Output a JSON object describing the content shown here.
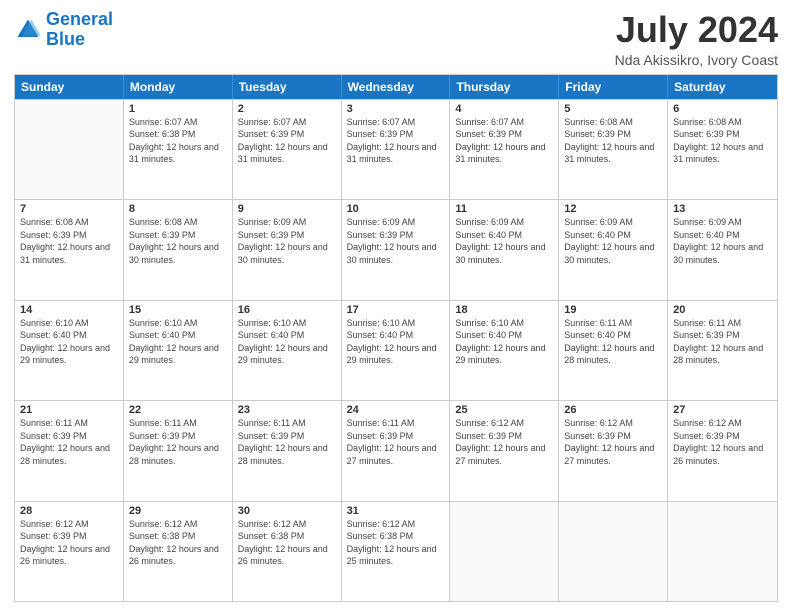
{
  "logo": {
    "line1": "General",
    "line2": "Blue"
  },
  "title": "July 2024",
  "location": "Nda Akissikro, Ivory Coast",
  "weekdays": [
    "Sunday",
    "Monday",
    "Tuesday",
    "Wednesday",
    "Thursday",
    "Friday",
    "Saturday"
  ],
  "weeks": [
    [
      {
        "day": "",
        "empty": true
      },
      {
        "day": "1",
        "sunrise": "6:07 AM",
        "sunset": "6:38 PM",
        "daylight": "12 hours and 31 minutes."
      },
      {
        "day": "2",
        "sunrise": "6:07 AM",
        "sunset": "6:39 PM",
        "daylight": "12 hours and 31 minutes."
      },
      {
        "day": "3",
        "sunrise": "6:07 AM",
        "sunset": "6:39 PM",
        "daylight": "12 hours and 31 minutes."
      },
      {
        "day": "4",
        "sunrise": "6:07 AM",
        "sunset": "6:39 PM",
        "daylight": "12 hours and 31 minutes."
      },
      {
        "day": "5",
        "sunrise": "6:08 AM",
        "sunset": "6:39 PM",
        "daylight": "12 hours and 31 minutes."
      },
      {
        "day": "6",
        "sunrise": "6:08 AM",
        "sunset": "6:39 PM",
        "daylight": "12 hours and 31 minutes."
      }
    ],
    [
      {
        "day": "7",
        "sunrise": "6:08 AM",
        "sunset": "6:39 PM",
        "daylight": "12 hours and 31 minutes."
      },
      {
        "day": "8",
        "sunrise": "6:08 AM",
        "sunset": "6:39 PM",
        "daylight": "12 hours and 30 minutes."
      },
      {
        "day": "9",
        "sunrise": "6:09 AM",
        "sunset": "6:39 PM",
        "daylight": "12 hours and 30 minutes."
      },
      {
        "day": "10",
        "sunrise": "6:09 AM",
        "sunset": "6:39 PM",
        "daylight": "12 hours and 30 minutes."
      },
      {
        "day": "11",
        "sunrise": "6:09 AM",
        "sunset": "6:40 PM",
        "daylight": "12 hours and 30 minutes."
      },
      {
        "day": "12",
        "sunrise": "6:09 AM",
        "sunset": "6:40 PM",
        "daylight": "12 hours and 30 minutes."
      },
      {
        "day": "13",
        "sunrise": "6:09 AM",
        "sunset": "6:40 PM",
        "daylight": "12 hours and 30 minutes."
      }
    ],
    [
      {
        "day": "14",
        "sunrise": "6:10 AM",
        "sunset": "6:40 PM",
        "daylight": "12 hours and 29 minutes."
      },
      {
        "day": "15",
        "sunrise": "6:10 AM",
        "sunset": "6:40 PM",
        "daylight": "12 hours and 29 minutes."
      },
      {
        "day": "16",
        "sunrise": "6:10 AM",
        "sunset": "6:40 PM",
        "daylight": "12 hours and 29 minutes."
      },
      {
        "day": "17",
        "sunrise": "6:10 AM",
        "sunset": "6:40 PM",
        "daylight": "12 hours and 29 minutes."
      },
      {
        "day": "18",
        "sunrise": "6:10 AM",
        "sunset": "6:40 PM",
        "daylight": "12 hours and 29 minutes."
      },
      {
        "day": "19",
        "sunrise": "6:11 AM",
        "sunset": "6:40 PM",
        "daylight": "12 hours and 28 minutes."
      },
      {
        "day": "20",
        "sunrise": "6:11 AM",
        "sunset": "6:39 PM",
        "daylight": "12 hours and 28 minutes."
      }
    ],
    [
      {
        "day": "21",
        "sunrise": "6:11 AM",
        "sunset": "6:39 PM",
        "daylight": "12 hours and 28 minutes."
      },
      {
        "day": "22",
        "sunrise": "6:11 AM",
        "sunset": "6:39 PM",
        "daylight": "12 hours and 28 minutes."
      },
      {
        "day": "23",
        "sunrise": "6:11 AM",
        "sunset": "6:39 PM",
        "daylight": "12 hours and 28 minutes."
      },
      {
        "day": "24",
        "sunrise": "6:11 AM",
        "sunset": "6:39 PM",
        "daylight": "12 hours and 27 minutes."
      },
      {
        "day": "25",
        "sunrise": "6:12 AM",
        "sunset": "6:39 PM",
        "daylight": "12 hours and 27 minutes."
      },
      {
        "day": "26",
        "sunrise": "6:12 AM",
        "sunset": "6:39 PM",
        "daylight": "12 hours and 27 minutes."
      },
      {
        "day": "27",
        "sunrise": "6:12 AM",
        "sunset": "6:39 PM",
        "daylight": "12 hours and 26 minutes."
      }
    ],
    [
      {
        "day": "28",
        "sunrise": "6:12 AM",
        "sunset": "6:39 PM",
        "daylight": "12 hours and 26 minutes."
      },
      {
        "day": "29",
        "sunrise": "6:12 AM",
        "sunset": "6:38 PM",
        "daylight": "12 hours and 26 minutes."
      },
      {
        "day": "30",
        "sunrise": "6:12 AM",
        "sunset": "6:38 PM",
        "daylight": "12 hours and 26 minutes."
      },
      {
        "day": "31",
        "sunrise": "6:12 AM",
        "sunset": "6:38 PM",
        "daylight": "12 hours and 25 minutes."
      },
      {
        "day": "",
        "empty": true
      },
      {
        "day": "",
        "empty": true
      },
      {
        "day": "",
        "empty": true
      }
    ]
  ]
}
